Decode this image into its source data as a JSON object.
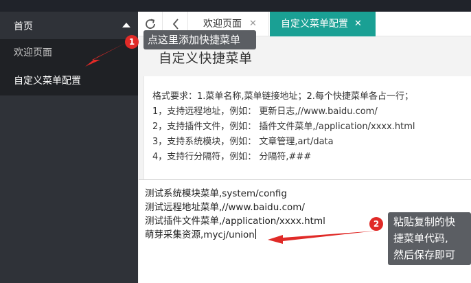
{
  "sidebar": {
    "header_label": "首页",
    "items": [
      {
        "label": "欢迎页面",
        "active": false
      },
      {
        "label": "自定义菜单配置",
        "active": true
      }
    ]
  },
  "tabs": [
    {
      "label": "欢迎页面",
      "close": "✕",
      "active": false
    },
    {
      "label": "自定义菜单配置",
      "close": "✕",
      "active": true
    }
  ],
  "content": {
    "page_title": "自定义快捷菜单",
    "help_lines": [
      "格式要求：1.菜单名称,菜单链接地址；2.每个快捷菜单各占一行；",
      "1，支持远程地址，例如：  更新日志,//www.baidu.com/",
      "2，支持插件文件，例如：  插件文件菜单,/application/xxxx.html",
      "3，支持系统模块，例如：  文章管理,art/data",
      "4，支持行分隔符，例如：  分隔符,###"
    ],
    "editor_lines": [
      "测试系统模块菜单,system/config",
      "测试远程地址菜单,//www.baidu.com/",
      "测试插件文件菜单,/application/xxxx.html",
      "萌芽采集资源,mycj/union"
    ]
  },
  "annotations": [
    {
      "number": "1",
      "text": "点这里添加快捷菜单"
    },
    {
      "number": "2",
      "lines": [
        "粘贴复制的快",
        "捷菜单代码,",
        "然后保存即可"
      ]
    }
  ],
  "colors": {
    "sidebar_bg": "#2f3238",
    "submenu_bg": "#1f2125",
    "active_tab": "#1aa094",
    "annotation_red": "#e02a27",
    "annotation_box": "#5b5e63"
  }
}
